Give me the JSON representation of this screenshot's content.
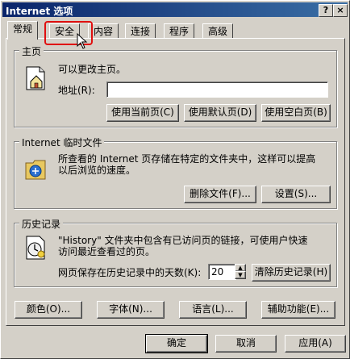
{
  "window": {
    "title": "Internet 选项",
    "help_label": "?",
    "close_label": "×"
  },
  "tabs": [
    {
      "label": "常规"
    },
    {
      "label": "安全"
    },
    {
      "label": "内容"
    },
    {
      "label": "连接"
    },
    {
      "label": "程序"
    },
    {
      "label": "高级"
    }
  ],
  "homepage": {
    "group_title": "主页",
    "description": "可以更改主页。",
    "address_label": "地址(R):",
    "address_value": "",
    "use_current": "使用当前页(C)",
    "use_default": "使用默认页(D)",
    "use_blank": "使用空白页(B)"
  },
  "temp_files": {
    "group_title": "Internet 临时文件",
    "description_line1": "所查看的 Internet 页存储在特定的文件夹中，这样可以提高",
    "description_line2": "以后浏览的速度。",
    "delete_files": "删除文件(F)...",
    "settings": "设置(S)..."
  },
  "history": {
    "group_title": "历史记录",
    "description_line1": "\"History\" 文件夹中包含有已访问页的链接，可使用户快速",
    "description_line2": "访问最近查看过的页。",
    "days_label": "网页保存在历史记录中的天数(K):",
    "days_value": "20",
    "clear_history": "清除历史记录(H)"
  },
  "bottom_buttons": {
    "colors": "颜色(O)...",
    "fonts": "字体(N)...",
    "languages": "语言(L)...",
    "accessibility": "辅助功能(E)..."
  },
  "dialog_buttons": {
    "ok": "确定",
    "cancel": "取消",
    "apply": "应用(A)"
  }
}
